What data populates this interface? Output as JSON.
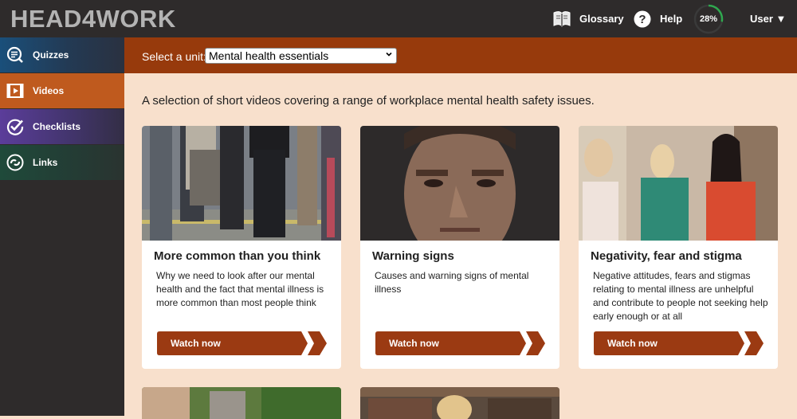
{
  "header": {
    "logo": "HEAD4WORK",
    "nav": {
      "glossary": "Glossary",
      "help": "Help",
      "progress": "28%",
      "progress_value": 0.28,
      "user": "User ▼"
    }
  },
  "sidebar": {
    "items": [
      {
        "label": "Quizzes",
        "icon": "quiz-icon"
      },
      {
        "label": "Videos",
        "icon": "video-icon"
      },
      {
        "label": "Checklists",
        "icon": "checklist-icon"
      },
      {
        "label": "Links",
        "icon": "link-icon"
      }
    ]
  },
  "unit": {
    "label": "Select a unit:",
    "selected": "Mental health essentials"
  },
  "intro": "A selection of short videos covering a range of workplace mental health safety issues.",
  "cards": [
    {
      "title": "More common than you think",
      "description": "Why we need to look after our mental health and the fact that mental illness is more common than most people think",
      "button": "Watch now"
    },
    {
      "title": "Warning signs",
      "description": "Causes and warning signs of mental illness",
      "button": "Watch now"
    },
    {
      "title": "Negativity, fear and stigma",
      "description": "Negative attitudes, fears and stigmas relating to mental illness are unhelpful and contribute to people not seeking help early enough or at all",
      "button": "Watch now"
    }
  ],
  "colors": {
    "accent": "#973a0c",
    "button": "#9b3a12",
    "active_sidebar": "#bf5a1e",
    "background": "#f8e0cc",
    "progress_ring": "#2fa84f"
  }
}
